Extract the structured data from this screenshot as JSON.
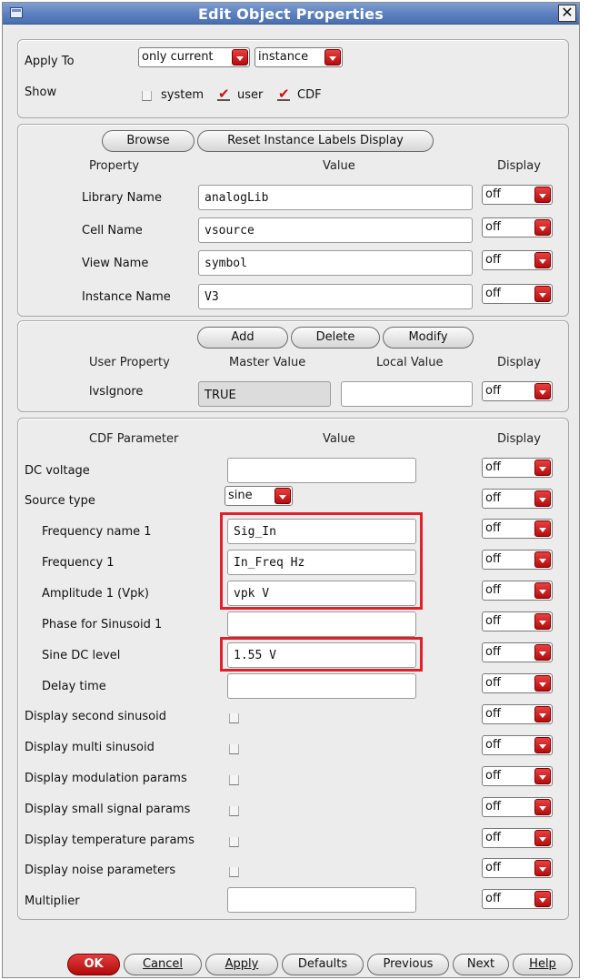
{
  "window": {
    "title": "Edit Object Properties"
  },
  "apply": {
    "apply_to_label": "Apply To",
    "apply_to_value": "only current",
    "scope_value": "instance",
    "show_label": "Show",
    "show_system": "system",
    "show_user": "user",
    "show_cdf": "CDF"
  },
  "props": {
    "browse": "Browse",
    "reset": "Reset Instance Labels Display",
    "col_property": "Property",
    "col_value": "Value",
    "col_display": "Display",
    "rows": [
      {
        "label": "Library Name",
        "value": "analogLib",
        "display": "off"
      },
      {
        "label": "Cell Name",
        "value": "vsource",
        "display": "off"
      },
      {
        "label": "View Name",
        "value": "symbol",
        "display": "off"
      },
      {
        "label": "Instance Name",
        "value": "V3",
        "display": "off"
      }
    ]
  },
  "user": {
    "add": "Add",
    "delete": "Delete",
    "modify": "Modify",
    "col_user_property": "User Property",
    "col_master": "Master Value",
    "col_local": "Local Value",
    "col_display": "Display",
    "row_label": "lvsIgnore",
    "row_master": "TRUE",
    "row_local": "",
    "row_display": "off"
  },
  "cdf": {
    "col_param": "CDF Parameter",
    "col_value": "Value",
    "col_display": "Display",
    "dc_voltage_label": "DC voltage",
    "dc_voltage_value": "",
    "source_type_label": "Source type",
    "source_type_value": "sine",
    "freq_name_label": "Frequency name 1",
    "freq_name_value": "Sig_In",
    "freq_label": "Frequency 1",
    "freq_value": "In_Freq Hz",
    "amp_label": "Amplitude 1 (Vpk)",
    "amp_value": "vpk V",
    "phase_label": "Phase for Sinusoid 1",
    "phase_value": "",
    "sine_dc_label": "Sine DC level",
    "sine_dc_value": "1.55 V",
    "delay_label": "Delay time",
    "delay_value": "",
    "second_sin_label": "Display second sinusoid",
    "multi_sin_label": "Display multi sinusoid",
    "modulation_label": "Display modulation params",
    "small_signal_label": "Display small signal params",
    "temperature_label": "Display temperature params",
    "noise_label": "Display noise parameters",
    "multiplier_label": "Multiplier",
    "multiplier_value": "",
    "display_value": "off"
  },
  "buttons": {
    "ok": "OK",
    "cancel": "Cancel",
    "apply": "Apply",
    "defaults": "Defaults",
    "previous": "Previous",
    "next": "Next",
    "help": "Help"
  },
  "colors": {
    "accent_red": "#b40d0d",
    "highlight": "#e0202a",
    "title_blue": "#5b7fbf"
  }
}
